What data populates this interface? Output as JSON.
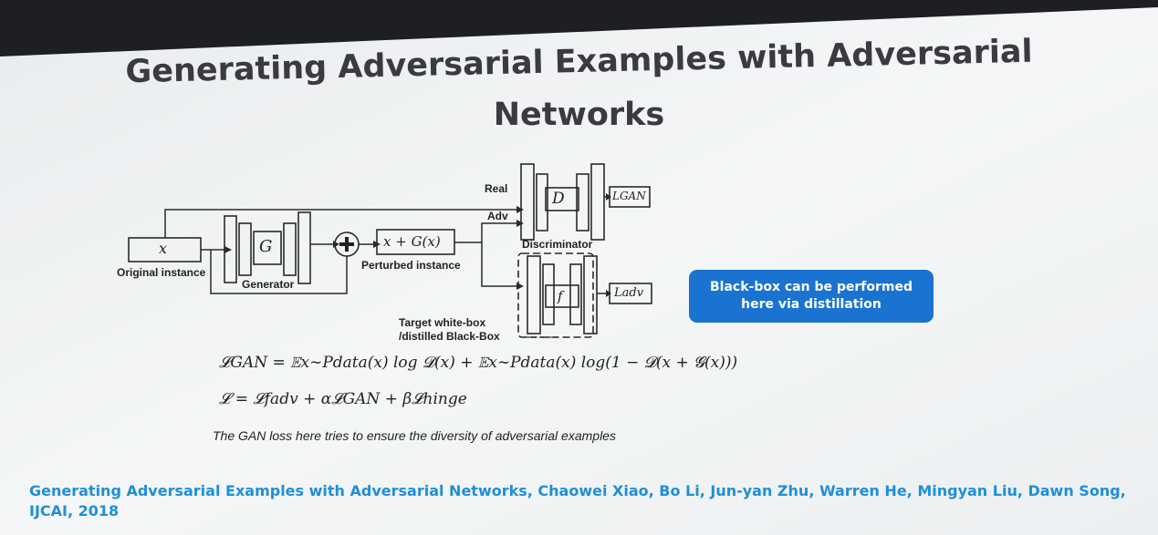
{
  "slide": {
    "title_line1": "Generating Adversarial Examples with Adversarial",
    "title_line2": "Networks"
  },
  "diagram": {
    "input_symbol": "x",
    "original_label": "Original instance",
    "generator_symbol": "G",
    "generator_label": "Generator",
    "perturbed_expr": "x + G(x)",
    "perturbed_label": "Perturbed instance",
    "real_label": "Real",
    "adv_label": "Adv",
    "discriminator_symbol": "D",
    "discriminator_label": "Discriminator",
    "gan_loss_label": "LGAN",
    "target_symbol": "f",
    "adv_loss_label": "Ladv",
    "target_label_line1": "Target white-box",
    "target_label_line2": "/distilled Black-Box"
  },
  "callout": {
    "line1": "Black-box can be performed",
    "line2": "here via distillation"
  },
  "formulas": {
    "gan_loss": "𝓛GAN = 𝔼x∼Pdata(x) log 𝓓(x) + 𝔼x∼Pdata(x) log(1 − 𝓓(x + 𝓖(x)))",
    "total_loss": "𝓛 = 𝓛fadv + α𝓛GAN + β𝓛hinge"
  },
  "note": "The GAN loss here tries to ensure the diversity of adversarial examples",
  "citation": "Generating Adversarial Examples with Adversarial Networks, Chaowei Xiao, Bo Li, Jun-yan Zhu, Warren He, Mingyan Liu, Dawn Song, IJCAI, 2018",
  "colors": {
    "slide_background": "#f1f3f5",
    "title": "#3b3b3f",
    "callout_bg": "#1a73d0",
    "citation": "#1f8fd8"
  }
}
